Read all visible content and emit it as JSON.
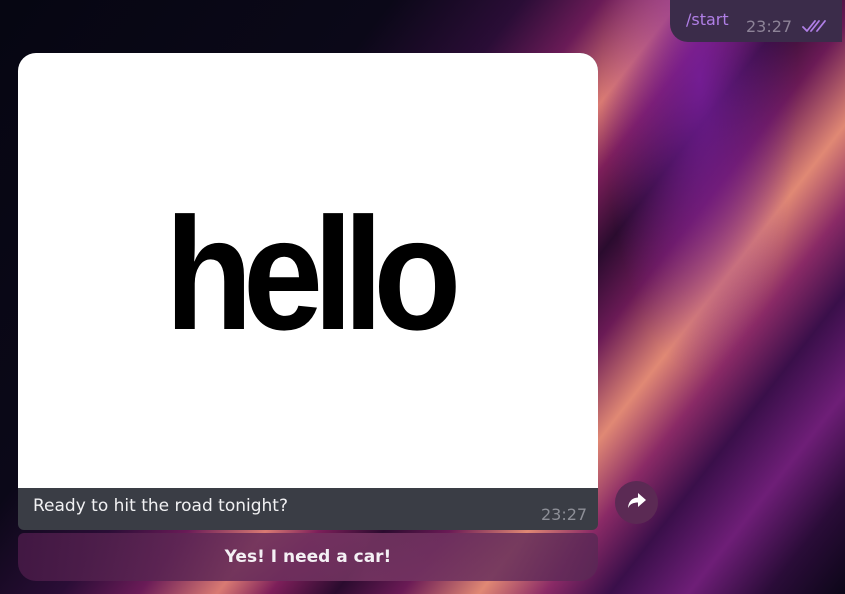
{
  "outgoing": {
    "text": "/start",
    "time": "23:27",
    "status_icon": "double-check-icon"
  },
  "incoming": {
    "image_text": "hello",
    "caption": "Ready to hit the road tonight?",
    "time": "23:27"
  },
  "keyboard": {
    "button_label": "Yes! I need a car!"
  },
  "share_icon": "forward-arrow-icon",
  "colors": {
    "accent": "#b07fe6",
    "bubble": "#3a3d45",
    "outgoing_bubble": "#3b2c4a"
  }
}
